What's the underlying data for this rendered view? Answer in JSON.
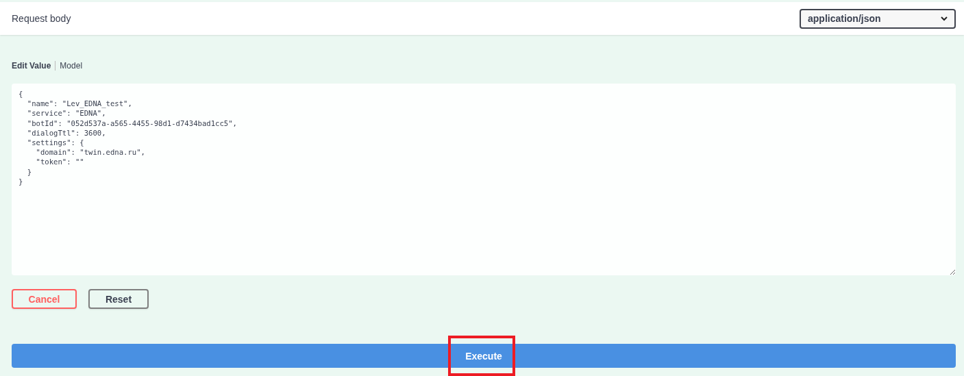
{
  "header": {
    "title": "Request body",
    "content_type": "application/json"
  },
  "tabs": [
    {
      "label": "Edit Value",
      "selected": true
    },
    {
      "label": "Model",
      "selected": false
    }
  ],
  "editor": {
    "value": "{\n  \"name\": \"Lev_EDNA_test\",\n  \"service\": \"EDNA\",\n  \"botId\": \"052d537a-a565-4455-98d1-d7434bad1cc5\",\n  \"dialogTtl\": 3600,\n  \"settings\": {\n    \"domain\": \"twin.edna.ru\",\n    \"token\": \"\"\n  }\n}"
  },
  "buttons": [
    {
      "label": "Cancel",
      "kind": "cancel"
    },
    {
      "label": "Reset",
      "kind": "reset"
    }
  ],
  "execute": {
    "label": "Execute",
    "highlighted": true
  }
}
